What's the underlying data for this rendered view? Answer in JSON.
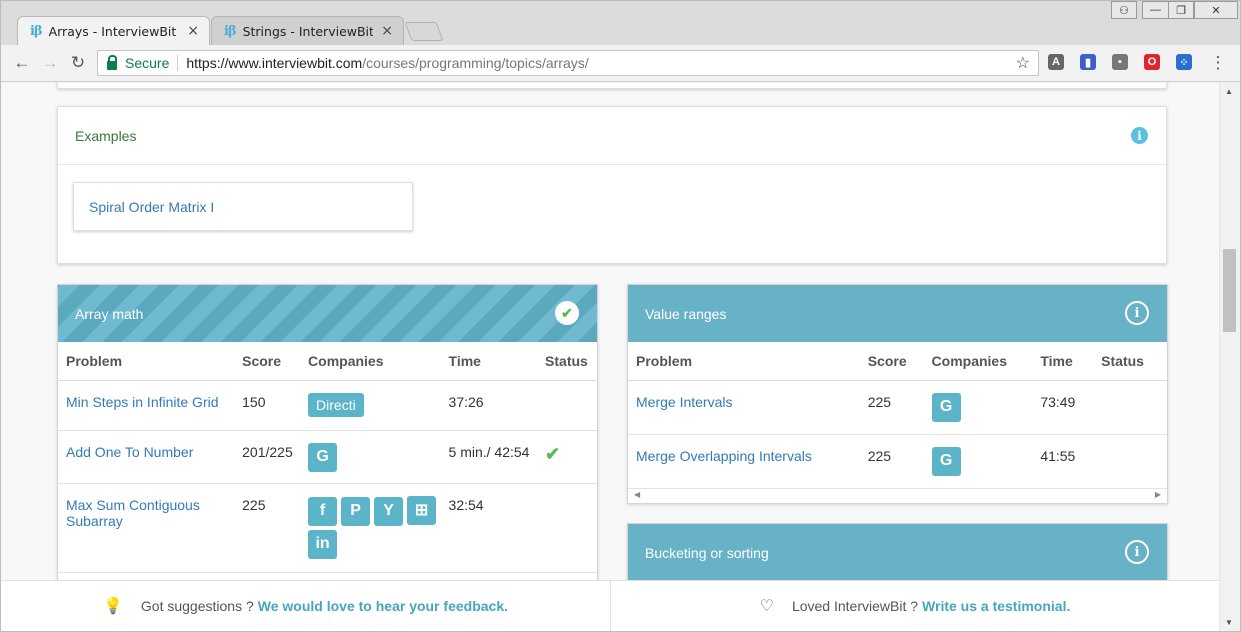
{
  "browser": {
    "tabs": [
      {
        "favicon": "iβ",
        "title": "Arrays - InterviewBit",
        "close": "×"
      },
      {
        "favicon": "iβ",
        "title": "Strings - InterviewBit",
        "close": "×"
      }
    ],
    "window_controls": {
      "user": "⚇",
      "minimize": "—",
      "restore": "❐",
      "close": "✕"
    },
    "back": "←",
    "forward": "→",
    "reload": "↻",
    "secure_label": "Secure",
    "url_host": "https://www.interviewbit.com",
    "url_path": "/courses/programming/topics/arrays/",
    "star": "☆",
    "menu": "⋮",
    "extensions": [
      {
        "name": "angular-icon",
        "glyph": "A",
        "color": "#666666"
      },
      {
        "name": "colorpick-icon",
        "glyph": "▮",
        "color": "#3b5fc4"
      },
      {
        "name": "puzzle-icon",
        "glyph": "▪",
        "color": "#777777"
      },
      {
        "name": "opera-icon",
        "glyph": "O",
        "color": "#e0262c"
      },
      {
        "name": "dots-icon",
        "glyph": "⁘",
        "color": "#2c6fcf"
      }
    ]
  },
  "examples": {
    "title": "Examples",
    "info": "i",
    "items": [
      "Spiral Order Matrix I"
    ]
  },
  "array_math": {
    "title": "Array math",
    "status_icon": "✔",
    "headers": [
      "Problem",
      "Score",
      "Companies",
      "Time",
      "Status"
    ],
    "rows": [
      {
        "problem": "Min Steps in Infinite Grid",
        "score": "150",
        "companies": [
          "Directi"
        ],
        "time": "37:26",
        "status": ""
      },
      {
        "problem": "Add One To Number",
        "score": "201/225",
        "companies": [
          "G"
        ],
        "time": "5 min./ 42:54",
        "status": "✔"
      },
      {
        "problem": "Max Sum Contiguous Subarray",
        "score": "225",
        "companies": [
          "f",
          "P",
          "Y",
          "⊞",
          "in"
        ],
        "time": "32:54",
        "status": ""
      }
    ]
  },
  "value_ranges": {
    "title": "Value ranges",
    "info": "i",
    "headers": [
      "Problem",
      "Score",
      "Companies",
      "Time",
      "Status"
    ],
    "rows": [
      {
        "problem": "Merge Intervals",
        "score": "225",
        "companies": [
          "G"
        ],
        "time": "73:49",
        "status": ""
      },
      {
        "problem": "Merge Overlapping Intervals",
        "score": "225",
        "companies": [
          "G"
        ],
        "time": "41:55",
        "status": ""
      }
    ]
  },
  "bucketing": {
    "title": "Bucketing or sorting",
    "info": "i"
  },
  "footer": {
    "left_text": "Got suggestions ?",
    "left_link": "We would love to hear your feedback.",
    "right_text": "Loved InterviewBit ?",
    "right_link": "Write us a testimonial."
  }
}
